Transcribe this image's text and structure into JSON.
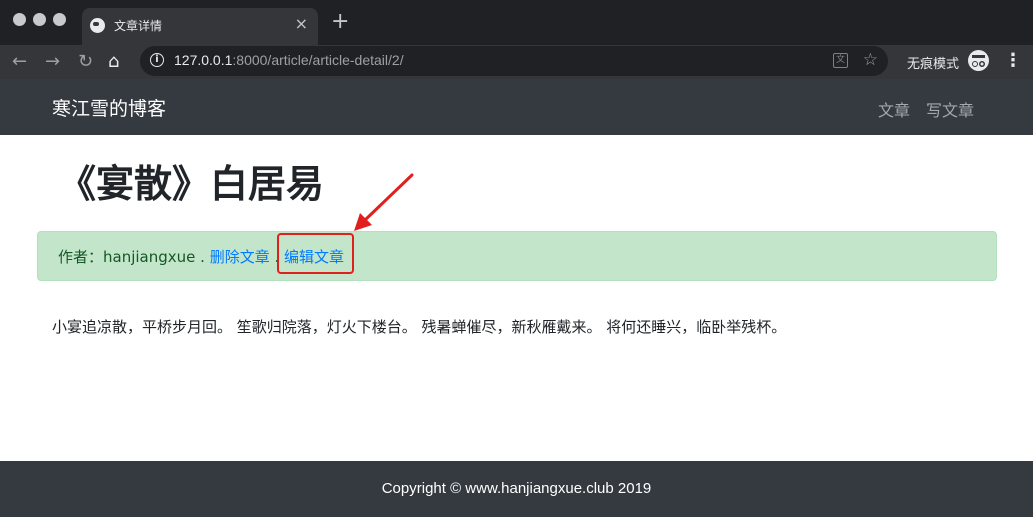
{
  "browser": {
    "tab_title": "文章详情",
    "new_tab_glyph": "+",
    "close_glyph": "×",
    "url_host": "127.0.0.1",
    "url_rest": ":8000/article/article-detail/2/",
    "incognito_label": "无痕模式"
  },
  "site": {
    "brand": "寒江雪的博客",
    "nav": [
      "文章",
      "写文章"
    ]
  },
  "article": {
    "title": "《宴散》白居易",
    "author_prefix": "作者：",
    "author": "hanjiangxue",
    "sep1": " . ",
    "delete_link": "删除文章",
    "sep2": " . ",
    "edit_link": "编辑文章",
    "body": "小宴追凉散，平桥步月回。 笙歌归院落，灯火下楼台。 残暑蝉催尽，新秋雁戴来。 将何还睡兴，临卧举残杯。"
  },
  "footer": {
    "copyright": "Copyright © www.hanjiangxue.club 2019"
  },
  "colors": {
    "navbar_bg": "#343a40",
    "alert_bg": "#c3e6cb",
    "link": "#007bff",
    "annotation_red": "#e0201e"
  },
  "icons": [
    "back-icon",
    "forward-icon",
    "reload-icon",
    "home-icon",
    "info-icon",
    "translate-icon",
    "star-icon",
    "incognito-icon",
    "menu-icon"
  ]
}
